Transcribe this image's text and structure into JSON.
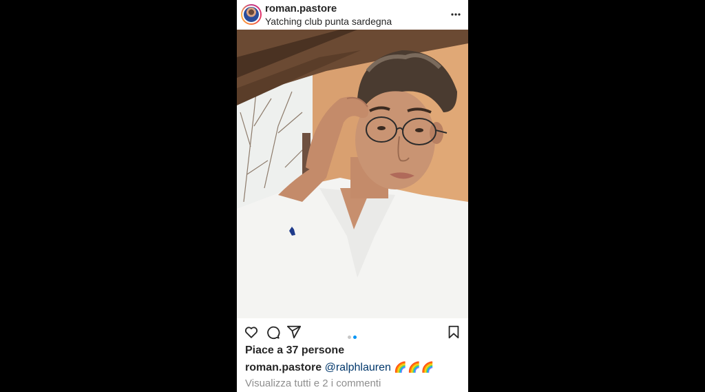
{
  "post": {
    "username": "roman.pastore",
    "location": "Yatching club punta sardegna",
    "likes_text": "Piace a 37 persone",
    "caption": {
      "username": "roman.pastore",
      "mention": "@ralphlauren",
      "emoji": "🌈🌈🌈"
    },
    "view_comments": "Visualizza tutti e 2 i commenti",
    "carousel": {
      "count": 2,
      "active_index": 1
    },
    "icons": {
      "more": "more-horizontal-icon",
      "like": "heart-icon",
      "comment": "comment-icon",
      "share": "paper-plane-icon",
      "save": "bookmark-icon"
    }
  },
  "colors": {
    "text": "#262626",
    "secondary_text": "#8e8e8e",
    "mention": "#00376b",
    "active_dot": "#0095f6",
    "background": "#000000"
  }
}
